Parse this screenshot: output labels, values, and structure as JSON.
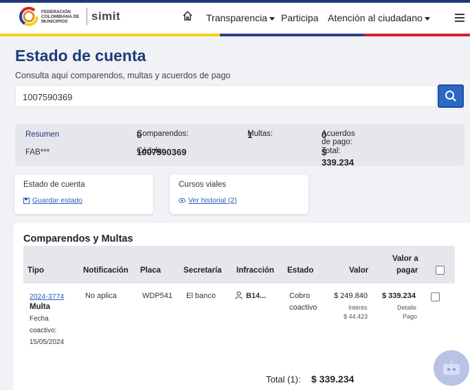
{
  "header": {
    "org_name": "FEDERACIÓN COLOMBIANA DE MUNICIPIOS",
    "brand": "simit",
    "nav": {
      "transparencia": "Transparencia",
      "participa": "Participa",
      "atencion": "Atención al ciudadano"
    }
  },
  "page": {
    "title": "Estado de cuenta",
    "subtitle": "Consulta aquí comparendos, multas y acuerdos de pago"
  },
  "search": {
    "value": "1007590369"
  },
  "summary": {
    "resumen_label": "Resumen",
    "name": "FAB***",
    "comparendos_label": "Comparendos:",
    "comparendos_value": "0",
    "multas_label": "Multas:",
    "multas_value": "1",
    "acuerdos_label": "Acuerdos de pago:",
    "acuerdos_value": "0",
    "cedula_label": "Cédula:",
    "cedula_value": "1007590369",
    "total_label": "Total:",
    "total_value": "$ 339.234"
  },
  "cards": {
    "estado": {
      "title": "Estado de cuenta",
      "link": "Guardar estado"
    },
    "cursos": {
      "title": "Cursos viales",
      "link": "Ver historial (2)"
    }
  },
  "table": {
    "title": "Comparendos y Multas",
    "headers": {
      "tipo": "Tipo",
      "notificacion": "Notificación",
      "placa": "Placa",
      "secretaria": "Secretaría",
      "infraccion": "Infracción",
      "estado": "Estado",
      "valor": "Valor",
      "valor_pagar_1": "Valor a",
      "valor_pagar_2": "pagar"
    },
    "rows": [
      {
        "id": "2024-3774",
        "tipo": "Multa",
        "fecha_label_1": "Fecha",
        "fecha_label_2": "coactivo:",
        "fecha": "15/05/2024",
        "notificacion": "No aplica",
        "placa": "WDP541",
        "secretaria": "El banco",
        "infraccion": "B14...",
        "estado_1": "Cobro",
        "estado_2": "coactivo",
        "valor": "$ 249.840",
        "interes_label": "Interés",
        "interes": "$ 44.423",
        "valor_pagar": "$ 339.234",
        "detalle_1": "Detalle",
        "detalle_2": "Pago"
      }
    ],
    "total_label": "Total (1):",
    "total_value": "$ 339.234"
  },
  "colors": {
    "brand_blue": "#1f3a7a",
    "search_button": "#2d68c4",
    "flag_yellow": "#f3d21b",
    "flag_blue": "#2d3f8f",
    "flag_red": "#d4202a"
  }
}
